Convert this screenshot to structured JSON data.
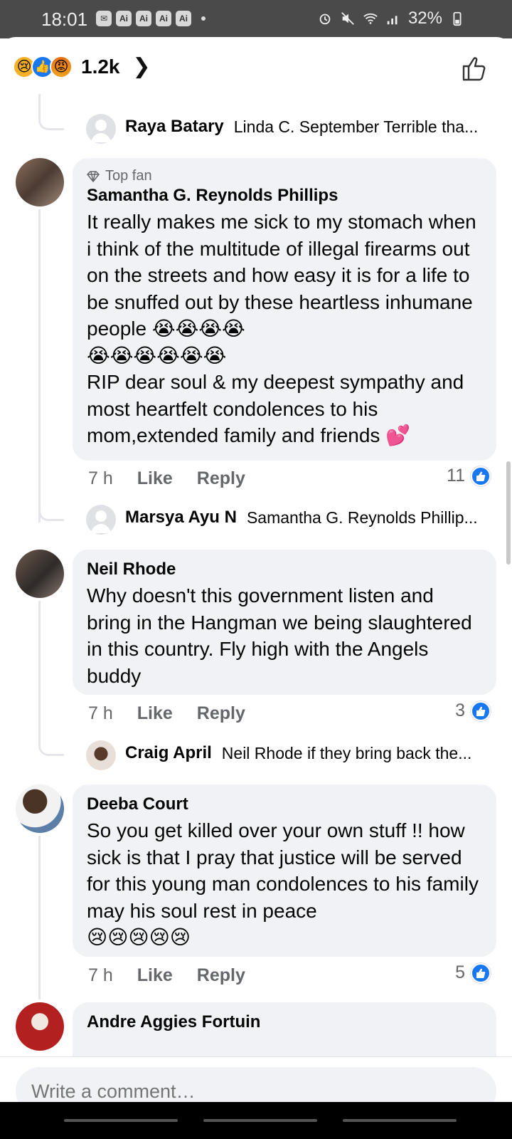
{
  "status_bar": {
    "time": "18:01",
    "apps": [
      "Ai",
      "Ai",
      "Ai",
      "Ai"
    ],
    "battery": "32%"
  },
  "header": {
    "reaction_count": "1.2k",
    "reactions": [
      "sad",
      "like",
      "angry"
    ]
  },
  "comments": [
    {
      "type": "reply",
      "author": "Raya Batary",
      "text": "Linda C. September Terrible tha..."
    },
    {
      "type": "comment",
      "badge": "Top fan",
      "author": "Samantha G. Reynolds Phillips",
      "body_line1": "It really makes me sick to my stomach when i think of the multitude of illegal firearms out on the streets and how easy it is for a life to be snuffed out by these heartless inhumane people 😭😭😭😭",
      "body_line2": "😭😭😭😭😭😭",
      "body_line3": "RIP dear soul & my deepest sympathy and most heartfelt condolences to his mom,extended family and friends 💕",
      "time": "7 h",
      "like_label": "Like",
      "reply_label": "Reply",
      "likes": "11"
    },
    {
      "type": "reply",
      "author": "Marsya Ayu N",
      "text": "Samantha G. Reynolds Phillip..."
    },
    {
      "type": "comment",
      "author": "Neil Rhode",
      "body": "Why doesn't  this government  listen and bring in the Hangman we being slaughtered in this country. Fly high with the Angels buddy",
      "time": "7 h",
      "like_label": "Like",
      "reply_label": "Reply",
      "likes": "3"
    },
    {
      "type": "reply",
      "author": "Craig April",
      "text": "Neil Rhode if they bring back the..."
    },
    {
      "type": "comment",
      "author": "Deeba Court",
      "body_line1": "So you get killed over your own stuff !! how sick is that I pray that justice will be served for this young man condolences to his family may his soul rest in peace",
      "body_line2": "😢😢😢😢😢",
      "time": "7 h",
      "like_label": "Like",
      "reply_label": "Reply",
      "likes": "5"
    },
    {
      "type": "comment",
      "author": "Andre Aggies Fortuin"
    }
  ],
  "composer": {
    "placeholder": "Write a comment…"
  },
  "colors": {
    "accent": "#1877f2",
    "bubble": "#f0f2f5",
    "muted": "#65676b"
  }
}
